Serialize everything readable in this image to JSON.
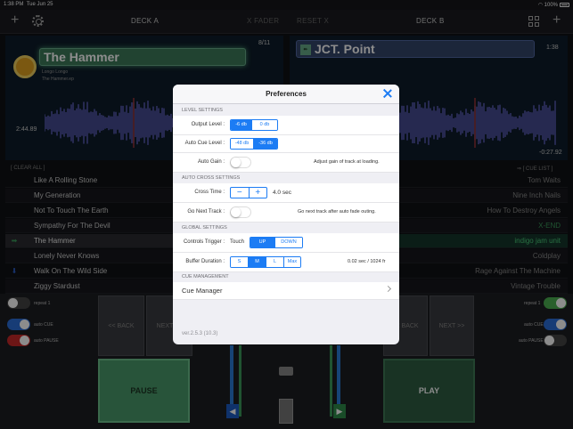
{
  "statusbar": {
    "time": "1:38 PM",
    "date": "Tue Jun 25",
    "battery": "100%",
    "wifi_icon": "wifi-icon"
  },
  "topbar": {
    "deck_a": "DECK A",
    "x_fader": "X FADER",
    "reset_x": "RESET X",
    "deck_b": "DECK B"
  },
  "deck_a": {
    "title": "The Hammer",
    "artist": "Longo Longo",
    "album": "The Hammer.ep",
    "track_pos": "8/11",
    "time_left": "2:44.89",
    "clear_all": "[ CLEAR ALL ]",
    "wave_color": "#6b6bd8"
  },
  "deck_b": {
    "title": "JCT. Point",
    "duration": "1:38",
    "remaining": "-0:27.92",
    "cue_list": "⇒ [ CUE LIST ]",
    "wave_color": "#6b6bd8"
  },
  "list_a": [
    "Like A Rolling Stone",
    "My Generation",
    "Not To Touch The Earth",
    "Sympathy For The Devil",
    "The Hammer",
    "Lonely Never Knows",
    "Walk On The Wild Side",
    "Ziggy Stardust"
  ],
  "list_b": [
    "Tom Waits",
    "Nine Inch Nails",
    "How To Destroy Angels",
    "X-END",
    "indigo jam unit",
    "Coldplay",
    "Rage Against The Machine",
    "Vintage Trouble"
  ],
  "controls": {
    "repeat": "repeat 1",
    "auto_cue": "auto CUE",
    "auto_pause": "auto PAUSE",
    "back": "<< BACK",
    "next": "NEXT >>",
    "pause": "PAUSE",
    "play": "PLAY"
  },
  "prefs": {
    "title": "Preferences",
    "level_settings": "LEVEL SETTINGS",
    "output_level": "Output Level :",
    "output_opts": [
      "-6 db",
      "0 db"
    ],
    "auto_cue_level": "Auto Cue Level :",
    "cue_opts": [
      "-48 db",
      "-36 db"
    ],
    "auto_gain": "Auto Gain :",
    "auto_gain_note": "Adjust gain of track at loading.",
    "auto_cross_settings": "AUTO CROSS SETTINGS",
    "cross_time": "Cross Time :",
    "cross_value": "4.0 sec",
    "stepper_minus": "−",
    "stepper_plus": "+",
    "go_next": "Go Next Track :",
    "go_next_note": "Go next track after auto fade outing.",
    "global_settings": "GLOBAL SETTINGS",
    "controls_trigger": "Controls Trigger :",
    "touch": "Touch",
    "trigger_opts": [
      "UP",
      "DOWN"
    ],
    "buffer_duration": "Buffer Duration :",
    "buffer_opts": [
      "S",
      "M",
      "L",
      "Max"
    ],
    "buffer_value": "0.02 sec / 1024 fr",
    "cue_management": "CUE MANAGEMENT",
    "cue_manager": "Cue Manager",
    "version": "ver.2.5.3 (10.3)"
  }
}
